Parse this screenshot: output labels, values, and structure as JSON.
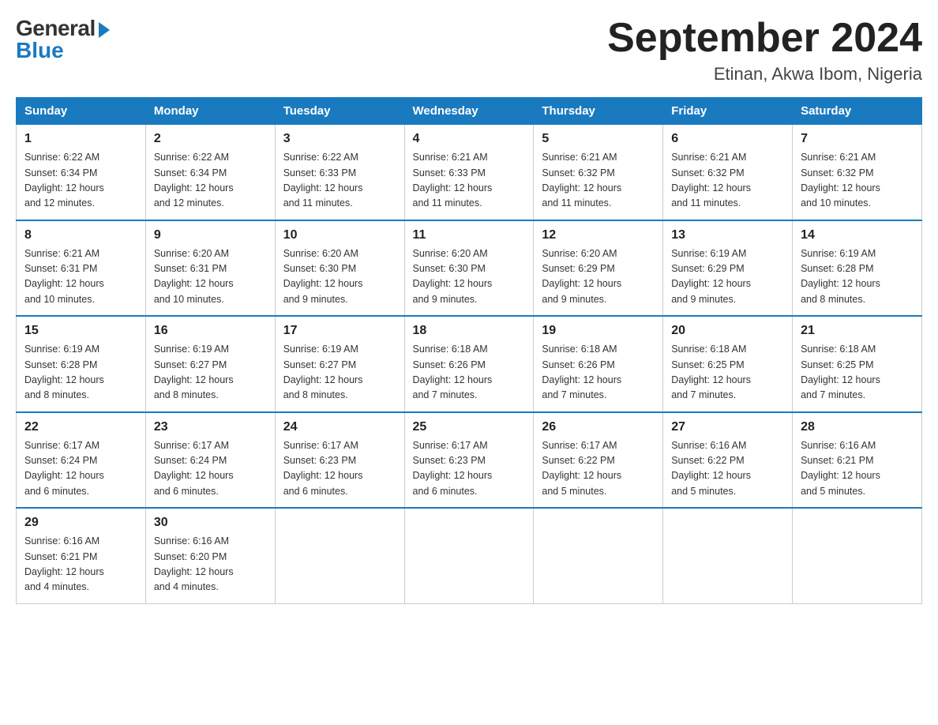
{
  "logo": {
    "general": "General",
    "blue": "Blue"
  },
  "calendar": {
    "title": "September 2024",
    "subtitle": "Etinan, Akwa Ibom, Nigeria"
  },
  "headers": [
    "Sunday",
    "Monday",
    "Tuesday",
    "Wednesday",
    "Thursday",
    "Friday",
    "Saturday"
  ],
  "weeks": [
    [
      {
        "day": "1",
        "sunrise": "6:22 AM",
        "sunset": "6:34 PM",
        "daylight": "12 hours and 12 minutes."
      },
      {
        "day": "2",
        "sunrise": "6:22 AM",
        "sunset": "6:34 PM",
        "daylight": "12 hours and 12 minutes."
      },
      {
        "day": "3",
        "sunrise": "6:22 AM",
        "sunset": "6:33 PM",
        "daylight": "12 hours and 11 minutes."
      },
      {
        "day": "4",
        "sunrise": "6:21 AM",
        "sunset": "6:33 PM",
        "daylight": "12 hours and 11 minutes."
      },
      {
        "day": "5",
        "sunrise": "6:21 AM",
        "sunset": "6:32 PM",
        "daylight": "12 hours and 11 minutes."
      },
      {
        "day": "6",
        "sunrise": "6:21 AM",
        "sunset": "6:32 PM",
        "daylight": "12 hours and 11 minutes."
      },
      {
        "day": "7",
        "sunrise": "6:21 AM",
        "sunset": "6:32 PM",
        "daylight": "12 hours and 10 minutes."
      }
    ],
    [
      {
        "day": "8",
        "sunrise": "6:21 AM",
        "sunset": "6:31 PM",
        "daylight": "12 hours and 10 minutes."
      },
      {
        "day": "9",
        "sunrise": "6:20 AM",
        "sunset": "6:31 PM",
        "daylight": "12 hours and 10 minutes."
      },
      {
        "day": "10",
        "sunrise": "6:20 AM",
        "sunset": "6:30 PM",
        "daylight": "12 hours and 9 minutes."
      },
      {
        "day": "11",
        "sunrise": "6:20 AM",
        "sunset": "6:30 PM",
        "daylight": "12 hours and 9 minutes."
      },
      {
        "day": "12",
        "sunrise": "6:20 AM",
        "sunset": "6:29 PM",
        "daylight": "12 hours and 9 minutes."
      },
      {
        "day": "13",
        "sunrise": "6:19 AM",
        "sunset": "6:29 PM",
        "daylight": "12 hours and 9 minutes."
      },
      {
        "day": "14",
        "sunrise": "6:19 AM",
        "sunset": "6:28 PM",
        "daylight": "12 hours and 8 minutes."
      }
    ],
    [
      {
        "day": "15",
        "sunrise": "6:19 AM",
        "sunset": "6:28 PM",
        "daylight": "12 hours and 8 minutes."
      },
      {
        "day": "16",
        "sunrise": "6:19 AM",
        "sunset": "6:27 PM",
        "daylight": "12 hours and 8 minutes."
      },
      {
        "day": "17",
        "sunrise": "6:19 AM",
        "sunset": "6:27 PM",
        "daylight": "12 hours and 8 minutes."
      },
      {
        "day": "18",
        "sunrise": "6:18 AM",
        "sunset": "6:26 PM",
        "daylight": "12 hours and 7 minutes."
      },
      {
        "day": "19",
        "sunrise": "6:18 AM",
        "sunset": "6:26 PM",
        "daylight": "12 hours and 7 minutes."
      },
      {
        "day": "20",
        "sunrise": "6:18 AM",
        "sunset": "6:25 PM",
        "daylight": "12 hours and 7 minutes."
      },
      {
        "day": "21",
        "sunrise": "6:18 AM",
        "sunset": "6:25 PM",
        "daylight": "12 hours and 7 minutes."
      }
    ],
    [
      {
        "day": "22",
        "sunrise": "6:17 AM",
        "sunset": "6:24 PM",
        "daylight": "12 hours and 6 minutes."
      },
      {
        "day": "23",
        "sunrise": "6:17 AM",
        "sunset": "6:24 PM",
        "daylight": "12 hours and 6 minutes."
      },
      {
        "day": "24",
        "sunrise": "6:17 AM",
        "sunset": "6:23 PM",
        "daylight": "12 hours and 6 minutes."
      },
      {
        "day": "25",
        "sunrise": "6:17 AM",
        "sunset": "6:23 PM",
        "daylight": "12 hours and 6 minutes."
      },
      {
        "day": "26",
        "sunrise": "6:17 AM",
        "sunset": "6:22 PM",
        "daylight": "12 hours and 5 minutes."
      },
      {
        "day": "27",
        "sunrise": "6:16 AM",
        "sunset": "6:22 PM",
        "daylight": "12 hours and 5 minutes."
      },
      {
        "day": "28",
        "sunrise": "6:16 AM",
        "sunset": "6:21 PM",
        "daylight": "12 hours and 5 minutes."
      }
    ],
    [
      {
        "day": "29",
        "sunrise": "6:16 AM",
        "sunset": "6:21 PM",
        "daylight": "12 hours and 4 minutes."
      },
      {
        "day": "30",
        "sunrise": "6:16 AM",
        "sunset": "6:20 PM",
        "daylight": "12 hours and 4 minutes."
      },
      null,
      null,
      null,
      null,
      null
    ]
  ],
  "labels": {
    "sunrise": "Sunrise:",
    "sunset": "Sunset:",
    "daylight": "Daylight:"
  }
}
